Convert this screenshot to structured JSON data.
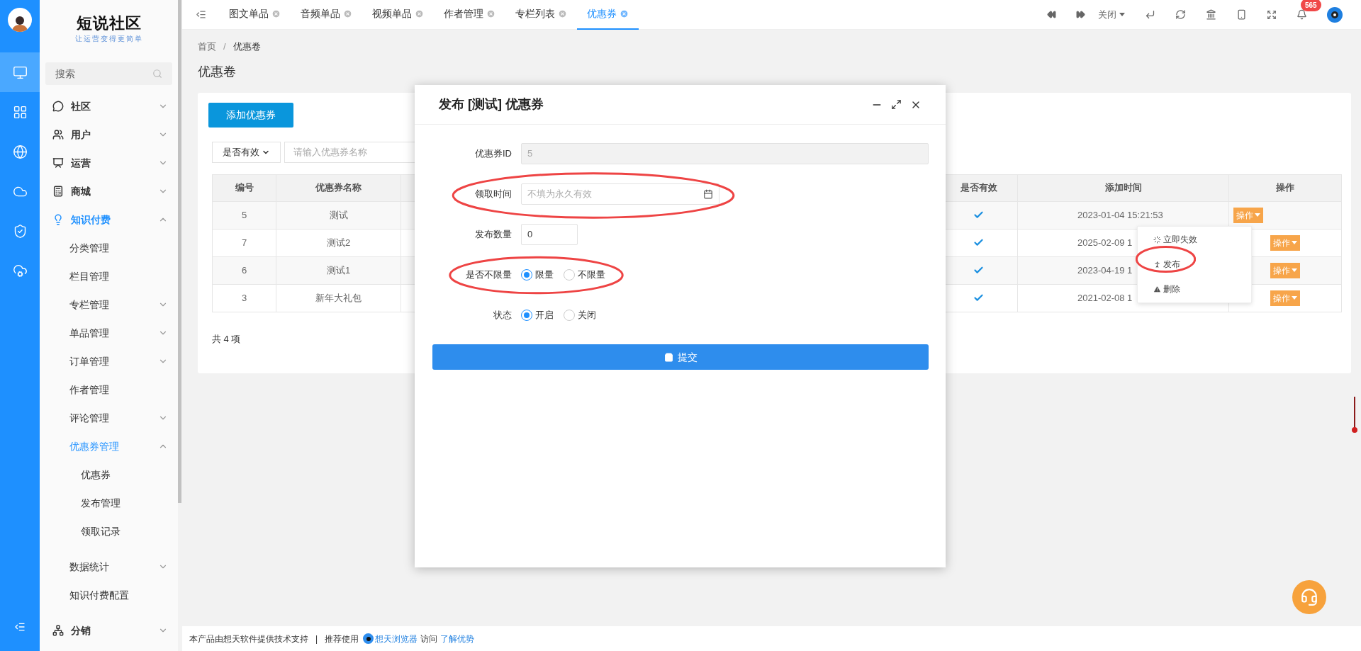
{
  "rail": {
    "items": [
      {
        "selected": true
      },
      {
        "selected": false
      },
      {
        "selected": false
      },
      {
        "selected": false
      },
      {
        "selected": false
      },
      {
        "selected": false
      }
    ]
  },
  "sidebar": {
    "logo_title": "短说社区",
    "logo_tagline": "让运营变得更简单",
    "search_placeholder": "搜索",
    "menu": [
      {
        "label": "社区",
        "expanded": false,
        "selected": false
      },
      {
        "label": "用户",
        "expanded": false,
        "selected": false
      },
      {
        "label": "运营",
        "expanded": false,
        "selected": false
      },
      {
        "label": "商城",
        "expanded": false,
        "selected": false
      },
      {
        "label": "知识付费",
        "expanded": true,
        "selected": true,
        "children": [
          {
            "label": "分类管理",
            "selected": false
          },
          {
            "label": "栏目管理",
            "selected": false
          },
          {
            "label": "专栏管理",
            "expanded": false,
            "selected": false
          },
          {
            "label": "单品管理",
            "expanded": false,
            "selected": false
          },
          {
            "label": "订单管理",
            "expanded": false,
            "selected": false
          },
          {
            "label": "作者管理",
            "selected": false
          },
          {
            "label": "评论管理",
            "expanded": false,
            "selected": false
          },
          {
            "label": "优惠券管理",
            "expanded": true,
            "selected": true,
            "children": [
              {
                "label": "优惠券",
                "selected": false
              },
              {
                "label": "发布管理",
                "selected": false
              },
              {
                "label": "领取记录",
                "selected": false
              }
            ]
          },
          {
            "label": "数据统计",
            "expanded": false,
            "selected": false
          },
          {
            "label": "知识付费配置",
            "selected": false
          }
        ]
      },
      {
        "label": "分销",
        "expanded": false,
        "selected": false
      }
    ]
  },
  "tabs": [
    {
      "label": "图文单品",
      "selected": false
    },
    {
      "label": "音频单品",
      "selected": false
    },
    {
      "label": "视频单品",
      "selected": false
    },
    {
      "label": "作者管理",
      "selected": false
    },
    {
      "label": "专栏列表",
      "selected": false
    },
    {
      "label": "优惠券",
      "selected": true
    }
  ],
  "toolbar": {
    "close_label": "关闭",
    "notification_count": "565"
  },
  "breadcrumb": {
    "items": [
      "首页",
      "优惠卷"
    ],
    "separator": "/"
  },
  "page_title": "优惠卷",
  "card": {
    "add_button": "添加优惠券",
    "filter_select": "是否有效",
    "search_placeholder": "请输入优惠券名称",
    "total": "共 4 项"
  },
  "table": {
    "columns_left": [
      "编号",
      "优惠券名称"
    ],
    "columns_right": [
      "是否有效",
      "添加时间",
      "操作"
    ],
    "rows": [
      {
        "id": "5",
        "name": "测试",
        "valid": true,
        "added": "2023-01-04 15:21:53",
        "action": "操作",
        "menu_open": true
      },
      {
        "id": "7",
        "name": "测试2",
        "valid": true,
        "added": "2025-02-09 1",
        "action": "操作",
        "menu_open": false
      },
      {
        "id": "6",
        "name": "测试1",
        "valid": true,
        "added": "2023-04-19 1",
        "action": "操作",
        "menu_open": false
      },
      {
        "id": "3",
        "name": "新年大礼包",
        "valid": true,
        "added": "2021-02-08 1",
        "action": "操作",
        "menu_open": false
      }
    ],
    "row_menu": [
      {
        "label": "立即失效"
      },
      {
        "label": "发布"
      },
      {
        "label": "删除"
      }
    ]
  },
  "modal": {
    "title": "发布 [测试] 优惠券",
    "fields": [
      {
        "kind": "text",
        "label": "优惠券ID",
        "value": "5",
        "disabled": true
      },
      {
        "kind": "date",
        "label": "领取时间",
        "placeholder": "不填为永久有效"
      },
      {
        "kind": "number",
        "label": "发布数量",
        "value": "0"
      },
      {
        "kind": "radio",
        "label": "是否不限量",
        "options": [
          {
            "label": "限量",
            "selected": true
          },
          {
            "label": "不限量",
            "selected": false
          }
        ]
      },
      {
        "kind": "radio",
        "label": "状态",
        "options": [
          {
            "label": "开启",
            "selected": true
          },
          {
            "label": "关闭",
            "selected": false
          }
        ]
      }
    ],
    "submit": "提交"
  },
  "footer": {
    "text": "本产品由想天软件提供技术支持",
    "separator": "|",
    "recommend": "推荐使用",
    "browser_link": "想天浏览器",
    "visit": "访问",
    "learn_link": "了解优势"
  }
}
